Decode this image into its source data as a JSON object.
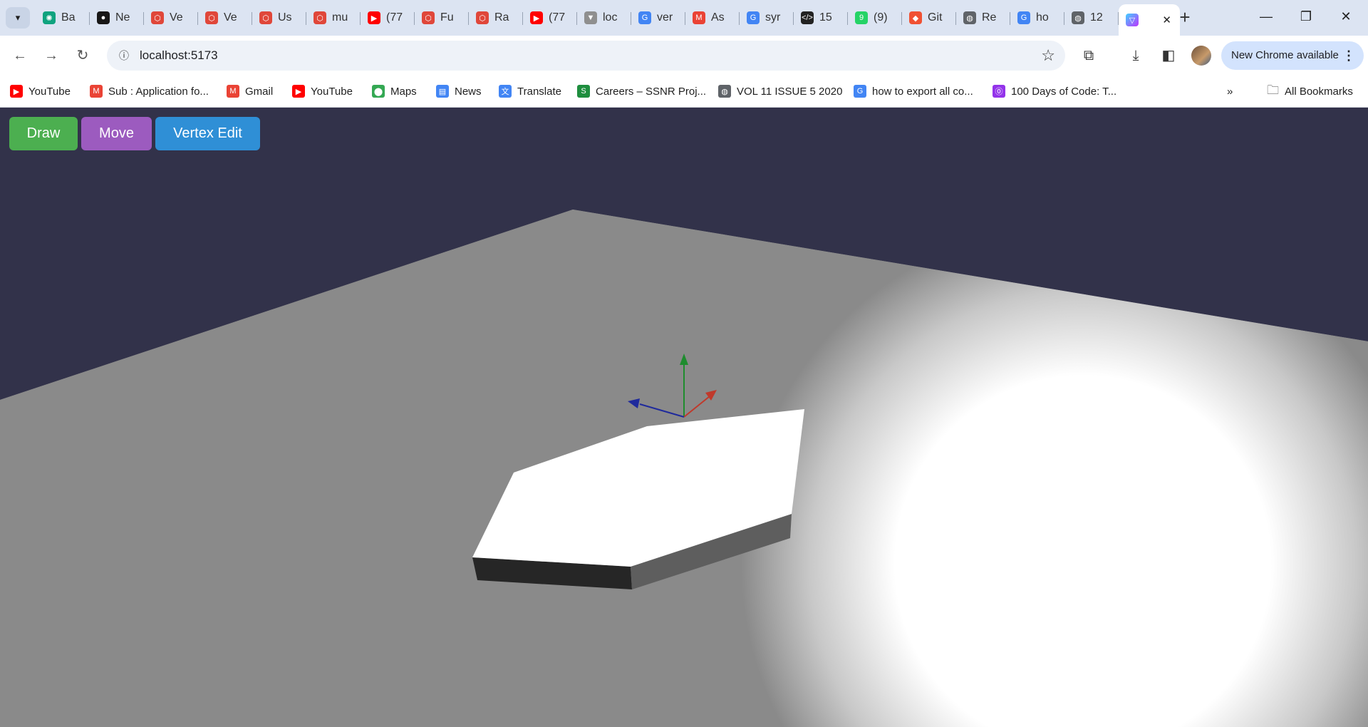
{
  "browser": {
    "tabs": [
      {
        "label": "Ba",
        "icon": "chatgpt-icon",
        "color": "#10a37f"
      },
      {
        "label": "Ne",
        "icon": "github-icon",
        "color": "#181717"
      },
      {
        "label": "Ve",
        "icon": "hexagon-icon",
        "color": "#e0473a"
      },
      {
        "label": "Ve",
        "icon": "hexagon-icon",
        "color": "#e0473a"
      },
      {
        "label": "Us",
        "icon": "hexagon-icon",
        "color": "#e0473a"
      },
      {
        "label": "mu",
        "icon": "hexagon-icon",
        "color": "#e0473a"
      },
      {
        "label": "(77",
        "icon": "youtube-icon",
        "color": "#ff0000"
      },
      {
        "label": "Fu",
        "icon": "hexagon-icon",
        "color": "#e0473a"
      },
      {
        "label": "Ra",
        "icon": "hexagon-icon",
        "color": "#e0473a"
      },
      {
        "label": "(77",
        "icon": "youtube-icon",
        "color": "#ff0000"
      },
      {
        "label": "loc",
        "icon": "funnel-icon",
        "color": "#8f8f8f"
      },
      {
        "label": "ver",
        "icon": "google-icon",
        "color": "#4285f4"
      },
      {
        "label": "As",
        "icon": "gmail-icon",
        "color": "#ea4335"
      },
      {
        "label": "syr",
        "icon": "google-icon",
        "color": "#4285f4"
      },
      {
        "label": "15",
        "icon": "code-icon",
        "color": "#222222"
      },
      {
        "label": "(9)",
        "icon": "whatsapp-icon",
        "color": "#25d366"
      },
      {
        "label": "Git",
        "icon": "git-icon",
        "color": "#f05133"
      },
      {
        "label": "Re",
        "icon": "globe-icon",
        "color": "#5f6368"
      },
      {
        "label": "ho",
        "icon": "google-icon",
        "color": "#4285f4"
      },
      {
        "label": "12",
        "icon": "globe-icon",
        "color": "#5f6368"
      }
    ],
    "active_tab": {
      "label": "",
      "icon": "vite-icon",
      "close": "✕"
    },
    "new_tab": "+",
    "window": {
      "minimize": "—",
      "restore": "❐",
      "close": "✕"
    },
    "url": "localhost:5173",
    "update_label": "New Chrome available",
    "update_menu": "⋮",
    "bookmarks": [
      {
        "label": "YouTube",
        "icon": "youtube-icon",
        "color": "#ff0000"
      },
      {
        "label": "Sub : Application fo...",
        "icon": "gmail-icon",
        "color": "#ea4335"
      },
      {
        "label": "Gmail",
        "icon": "gmail-icon",
        "color": "#ea4335"
      },
      {
        "label": "YouTube",
        "icon": "youtube-icon",
        "color": "#ff0000"
      },
      {
        "label": "Maps",
        "icon": "maps-icon",
        "color": "#34a853"
      },
      {
        "label": "News",
        "icon": "news-icon",
        "color": "#4285f4"
      },
      {
        "label": "Translate",
        "icon": "translate-icon",
        "color": "#4285f4"
      },
      {
        "label": "Careers – SSNR Proj...",
        "icon": "ssnr-icon",
        "color": "#1e8e3e"
      },
      {
        "label": "VOL 11 ISSUE 5 2020",
        "icon": "globe-icon",
        "color": "#5f6368"
      },
      {
        "label": "how to export all co...",
        "icon": "google-icon",
        "color": "#4285f4"
      },
      {
        "label": "100 Days of Code: T...",
        "icon": "course-icon",
        "color": "#9333ea"
      }
    ],
    "bookmarks_overflow": "»",
    "all_bookmarks": "All Bookmarks"
  },
  "app": {
    "modes": [
      {
        "label": "Draw",
        "color": "#4caf50"
      },
      {
        "label": "Move",
        "color": "#9c5bbf"
      },
      {
        "label": "Vertex Edit",
        "color": "#2f8fd6"
      }
    ],
    "scene": {
      "background": "#32324a",
      "ground_color": "#8a8a8a",
      "shape_top_color": "#ffffff",
      "shape_side_dark": "#262626",
      "shape_side_mid": "#5e5e5e",
      "axis_x_color": "#c0392b",
      "axis_y_color": "#1e8c2e",
      "axis_z_color": "#1f2a9c"
    }
  }
}
